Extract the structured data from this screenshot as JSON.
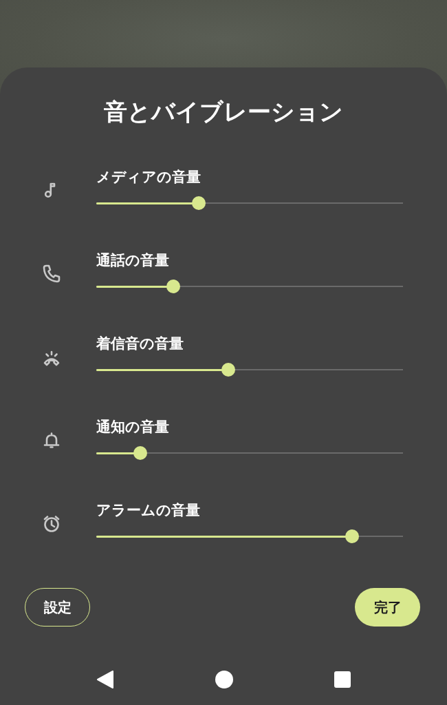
{
  "sheet": {
    "title": "音とバイブレーション"
  },
  "volumes": [
    {
      "kind": "media",
      "label": "メディアの音量",
      "level": 0.334
    },
    {
      "kind": "call",
      "label": "通話の音量",
      "level": 0.25
    },
    {
      "kind": "ring",
      "label": "着信音の音量",
      "level": 0.43
    },
    {
      "kind": "notification",
      "label": "通知の音量",
      "level": 0.143
    },
    {
      "kind": "alarm",
      "label": "アラームの音量",
      "level": 0.834
    }
  ],
  "buttons": [
    {
      "kind": "outlined",
      "label": "設定"
    },
    {
      "kind": "filled",
      "label": "完了"
    }
  ]
}
